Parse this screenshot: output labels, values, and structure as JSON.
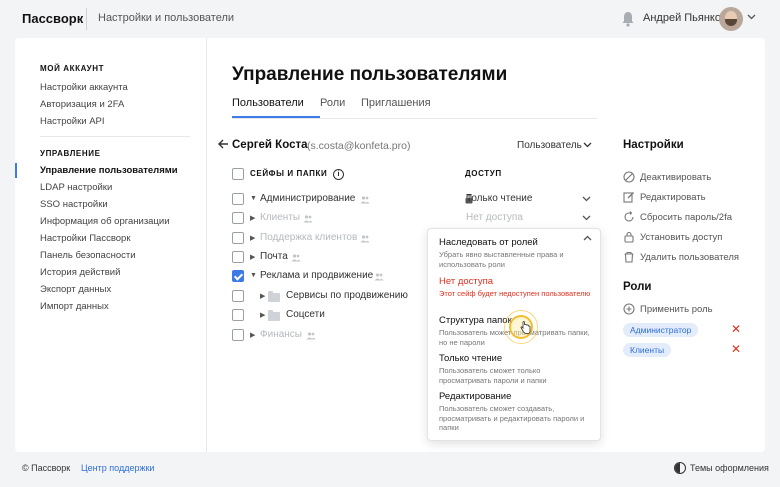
{
  "app": {
    "brand": "Пассворк",
    "section": "Настройки и пользователи"
  },
  "header": {
    "user_name": "Андрей Пьянков"
  },
  "sidebar": {
    "account_title": "МОЙ АККАУНТ",
    "account_items": [
      "Настройки аккаунта",
      "Авторизация и 2FA",
      "Настройки API"
    ],
    "manage_title": "УПРАВЛЕНИЕ",
    "manage_items": [
      "Управление пользователями",
      "LDAP настройки",
      "SSO настройки",
      "Информация об организации",
      "Настройки Пассворк",
      "Панель безопасности",
      "История действий",
      "Экспорт данных",
      "Импорт данных"
    ]
  },
  "main": {
    "title": "Управление пользователями",
    "tabs": [
      "Пользователи",
      "Роли",
      "Приглашения"
    ],
    "user": {
      "name": "Сергей Коста",
      "email": "(s.costa@konfeta.pro)",
      "role_select": "Пользователь"
    },
    "col_vaults": "СЕЙФЫ И ПАПКИ",
    "col_access": "ДОСТУП",
    "rows": [
      {
        "label": "Администрирование",
        "access": "Только чтение"
      },
      {
        "label": "Клиенты",
        "access": "Нет доступа"
      },
      {
        "label": "Поддержка клиентов",
        "access": ""
      },
      {
        "label": "Почта",
        "access": ""
      },
      {
        "label": "Реклама и продвижение",
        "access": ""
      },
      {
        "label": "Сервисы по продвижению",
        "access": ""
      },
      {
        "label": "Соцсети",
        "access": ""
      },
      {
        "label": "Финансы",
        "access": ""
      }
    ]
  },
  "dropdown": {
    "options": [
      {
        "title": "Наследовать от ролей",
        "desc": "Убрать явно выставленные права и использовать роли"
      },
      {
        "title": "Нет доступа",
        "desc": "Этот сейф будет недоступен пользователю"
      },
      {
        "title": "Структура папок",
        "desc": "Пользователь может просматривать папки, но не пароли"
      },
      {
        "title": "Только чтение",
        "desc": "Пользователь сможет только просматривать пароли и папки"
      },
      {
        "title": "Редактирование",
        "desc": "Пользователь сможет создавать, просматривать и редактировать пароли и папки"
      }
    ]
  },
  "settings": {
    "title": "Настройки",
    "actions": [
      "Деактивировать",
      "Редактировать",
      "Сбросить пароль/2fa",
      "Установить доступ",
      "Удалить пользователя"
    ]
  },
  "roles": {
    "title": "Роли",
    "add": "Применить роль",
    "items": [
      "Администратор",
      "Клиенты"
    ]
  },
  "footer": {
    "copyright": "© Пассворк",
    "support": "Центр поддержки",
    "theme": "Темы оформления"
  },
  "colors": {
    "accent": "#3d7be6",
    "danger": "#e0301e",
    "badge_bg": "#e3ecfb"
  }
}
